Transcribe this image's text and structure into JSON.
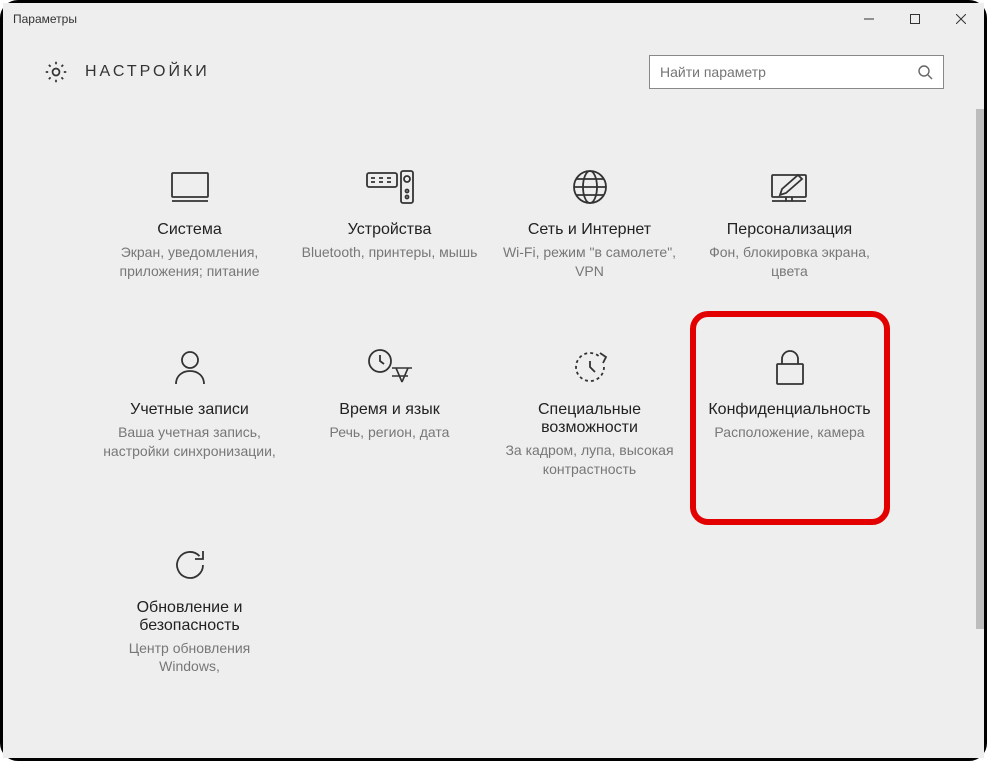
{
  "window": {
    "title": "Параметры"
  },
  "header": {
    "title": "НАСТРОЙКИ",
    "search_placeholder": "Найти параметр"
  },
  "tiles": [
    {
      "id": "system",
      "title": "Система",
      "desc": "Экран, уведомления, приложения; питание"
    },
    {
      "id": "devices",
      "title": "Устройства",
      "desc": "Bluetooth, принтеры, мышь"
    },
    {
      "id": "network",
      "title": "Сеть и Интернет",
      "desc": "Wi-Fi, режим \"в самолете\", VPN"
    },
    {
      "id": "personalization",
      "title": "Персонализация",
      "desc": "Фон, блокировка экрана, цвета"
    },
    {
      "id": "accounts",
      "title": "Учетные записи",
      "desc": "Ваша учетная запись, настройки синхронизации,"
    },
    {
      "id": "timelang",
      "title": "Время и язык",
      "desc": "Речь, регион, дата"
    },
    {
      "id": "ease",
      "title": "Специальные возможности",
      "desc": "За кадром, лупа, высокая контрастность"
    },
    {
      "id": "privacy",
      "title": "Конфиденциальность",
      "desc": "Расположение, камера",
      "highlight": true
    },
    {
      "id": "update",
      "title": "Обновление и безопасность",
      "desc": "Центр обновления Windows,"
    }
  ]
}
